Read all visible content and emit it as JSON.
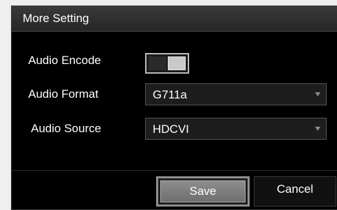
{
  "dialog": {
    "title": "More Setting",
    "audio_encode": {
      "label": "Audio Encode",
      "enabled": true
    },
    "audio_format": {
      "label": "Audio Format",
      "value": "G711a"
    },
    "audio_source": {
      "label": "Audio Source",
      "value": "HDCVI"
    },
    "buttons": {
      "save": "Save",
      "cancel": "Cancel"
    }
  },
  "colors": {
    "dialog_bg": "#000000",
    "title_bg": "#2f2f2f",
    "save_button": "#7d7d7d"
  }
}
